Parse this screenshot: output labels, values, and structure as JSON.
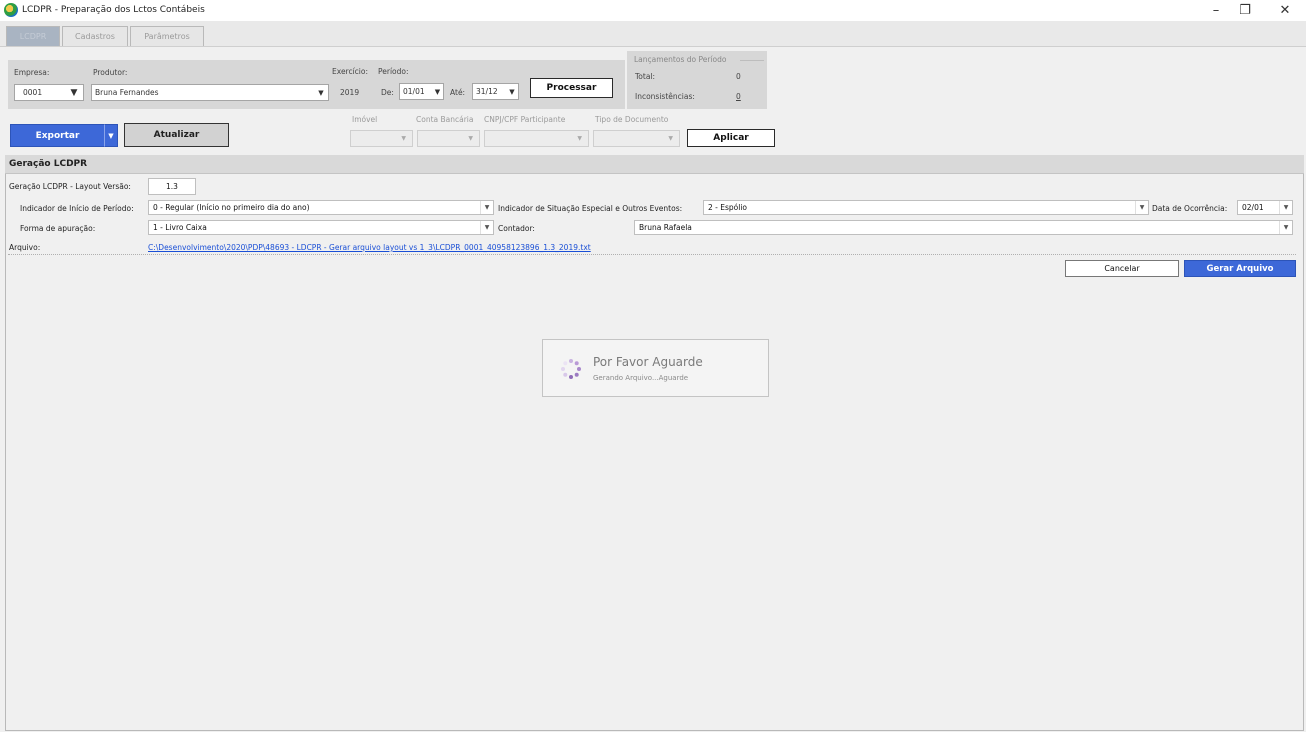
{
  "window": {
    "title": "LCDPR - Preparação dos Lctos Contábeis",
    "controls": {
      "minimize": "–",
      "restore": "❐",
      "close": "✕"
    }
  },
  "tabs": [
    {
      "label": "LCDPR",
      "active": true
    },
    {
      "label": "Cadastros",
      "active": false
    },
    {
      "label": "Parâmetros",
      "active": false
    }
  ],
  "header": {
    "empresa_label": "Empresa:",
    "empresa_value": "0001",
    "produtor_label": "Produtor:",
    "produtor_value": "Bruna Fernandes",
    "exercicio_label": "Exercício:",
    "exercicio_value": "2019",
    "periodo_label": "Período:",
    "de_label": "De:",
    "de_value": "01/01",
    "ate_label": "Até:",
    "ate_value": "31/12",
    "processar_label": "Processar"
  },
  "lancamentos": {
    "legend": "Lançamentos do Período",
    "total_label": "Total:",
    "total_value": "0",
    "inconsistencias_label": "Inconsistências:",
    "inconsistencias_value": "0"
  },
  "actions": {
    "exportar_label": "Exportar",
    "atualizar_label": "Atualizar",
    "aplicar_label": "Aplicar"
  },
  "filters": {
    "imovel_label": "Imóvel",
    "conta_label": "Conta Bancária",
    "cnpj_label": "CNPJ/CPF Participante",
    "tipo_label": "Tipo de Documento"
  },
  "geracao": {
    "section_title": "Geração LCDPR",
    "versao_label": "Geração LCDPR - Layout Versão:",
    "versao_value": "1.3",
    "indicador_inicio_label": "Indicador de Início de Período:",
    "indicador_inicio_value": "0 - Regular (Início no primeiro dia do ano)",
    "indicador_situacao_label": "Indicador de Situação Especial e Outros Eventos:",
    "indicador_situacao_value": "2 - Espólio",
    "data_ocorrencia_label": "Data de Ocorrência:",
    "data_ocorrencia_value": "02/01",
    "forma_label": "Forma de apuração:",
    "forma_value": "1 - Livro Caixa",
    "contador_label": "Contador:",
    "contador_value": "Bruna Rafaela",
    "arquivo_label": "Arquivo:",
    "arquivo_value": "C:\\Desenvolvimento\\2020\\PDP\\48693 - LDCPR - Gerar arquivo layout vs 1_3\\LCDPR_0001_40958123896_1.3_2019.txt",
    "cancelar_label": "Cancelar",
    "gerar_label": "Gerar Arquivo"
  },
  "wait": {
    "title": "Por Favor Aguarde",
    "subtitle": "Gerando Arquivo...Aguarde"
  },
  "colors": {
    "primary_button": "#3d68d8",
    "link": "#1a4fd6",
    "panel": "#d7d7d7"
  }
}
